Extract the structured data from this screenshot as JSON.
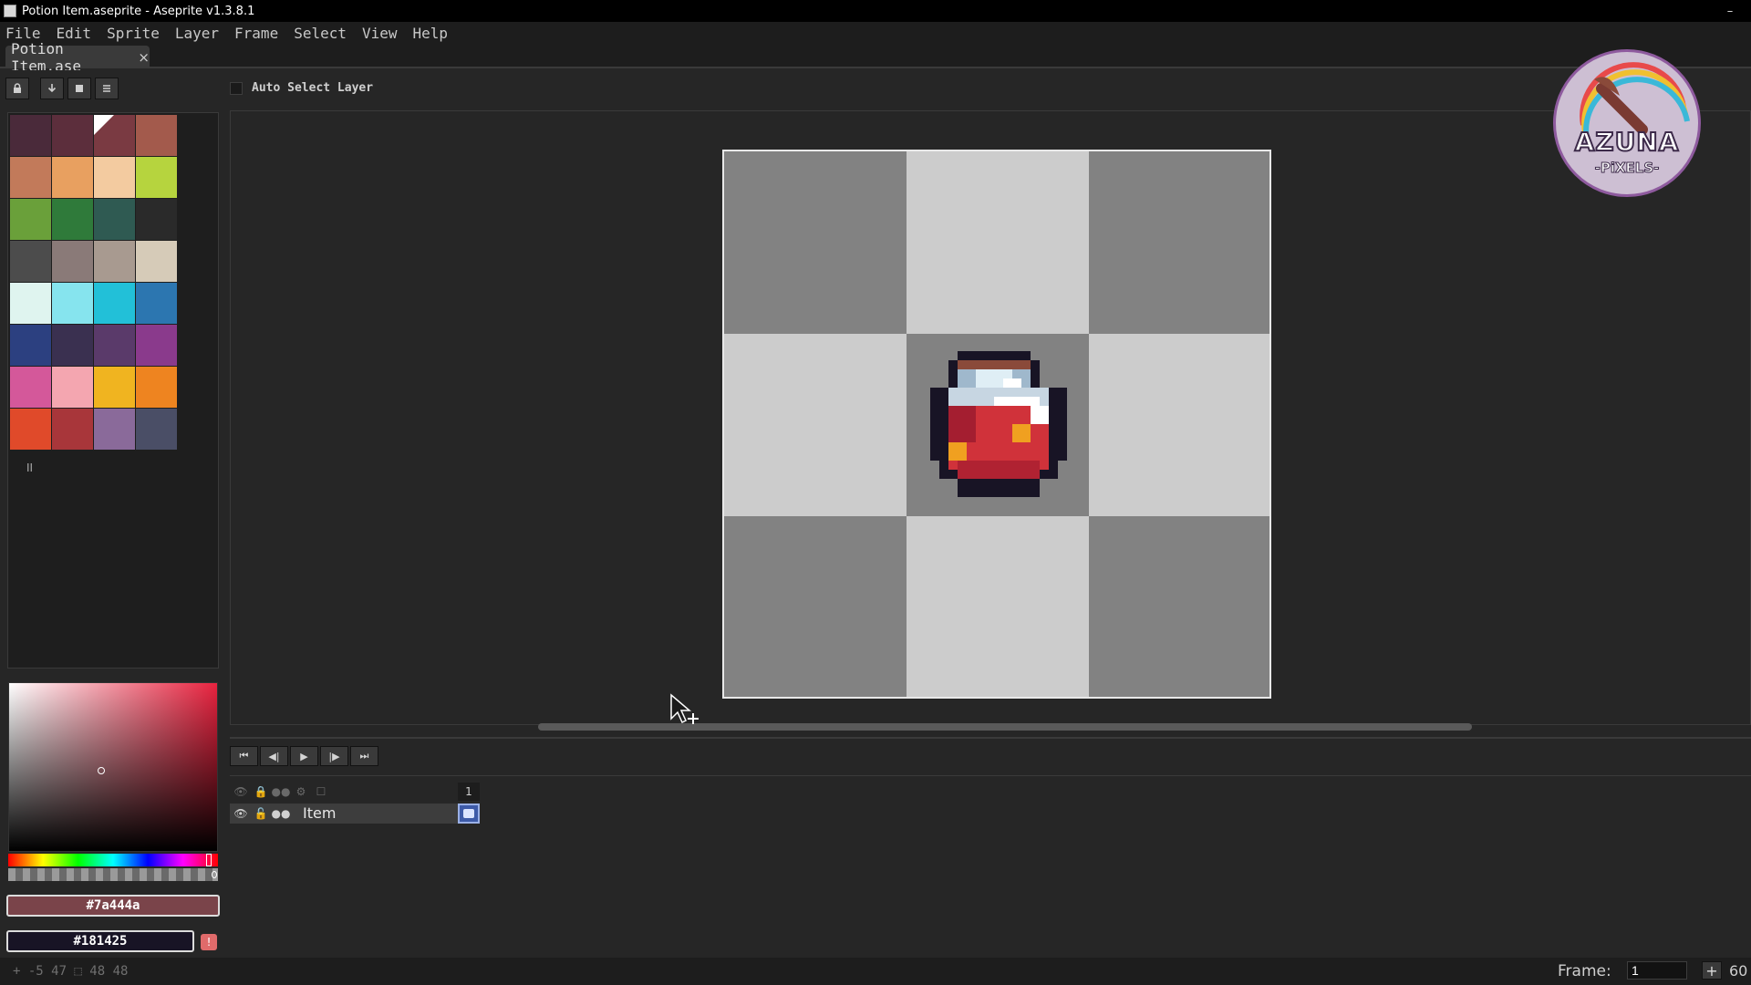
{
  "window": {
    "title": "Potion Item.aseprite - Aseprite v1.3.8.1",
    "minimize": "–"
  },
  "menu": [
    "File",
    "Edit",
    "Sprite",
    "Layer",
    "Frame",
    "Select",
    "View",
    "Help"
  ],
  "tab": {
    "label": "Potion Item.ase",
    "close": "×"
  },
  "toolbar": {
    "auto_select_label": "Auto Select Layer",
    "auto_select_checked": false
  },
  "palette": {
    "swatches": [
      "#4a2a3a",
      "#5c2e3c",
      "#7a3a42",
      "#a35a4c",
      "#c27a5a",
      "#e8a060",
      "#f3cba0",
      "#b6d43e",
      "#6aa03a",
      "#2f7a3a",
      "#2f5a52",
      "#2a2a2a",
      "#4c4c4c",
      "#8a7a78",
      "#a89a90",
      "#d6cbb8",
      "#dff4ef",
      "#86e4ee",
      "#22c0d8",
      "#2c76b0",
      "#2c4080",
      "#3a3050",
      "#5a3a6a",
      "#8a3a8c",
      "#d4589a",
      "#f4a6b0",
      "#f0b420",
      "#ee8420",
      "#e04a2a",
      "#a8363a",
      "#8a6a9a",
      "#4a4e66"
    ]
  },
  "colors": {
    "foreground": "#7a444a",
    "background": "#181425",
    "picker_hue": "#e8233f"
  },
  "canvas": {
    "logo_text": "AZUNA",
    "logo_sub": "-PiXELS-"
  },
  "timeline": {
    "frame_number": "1",
    "layer_name": "Item"
  },
  "statusbar": {
    "coords": "+ -5 47  ⬚ 48 48",
    "frame_label": "Frame:",
    "frame_value": "1",
    "zoom": "60"
  }
}
